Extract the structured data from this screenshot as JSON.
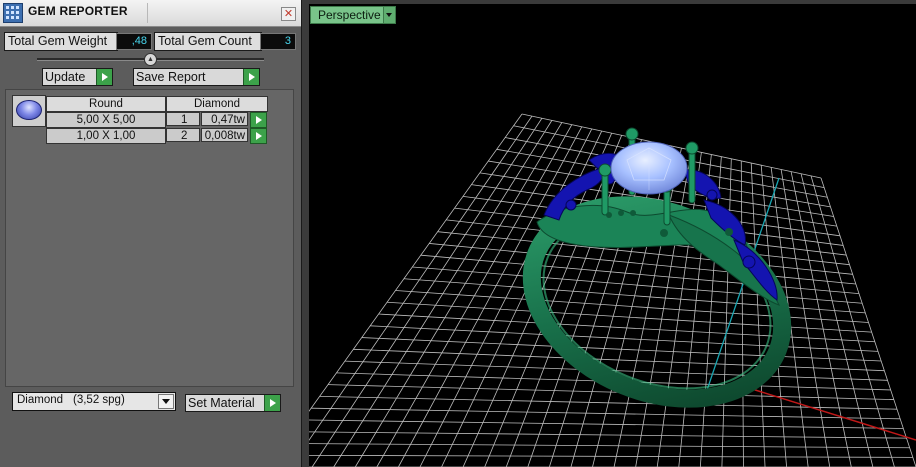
{
  "panel": {
    "title": "GEM REPORTER",
    "close_label": "✕",
    "total_weight_label": "Total Gem Weight",
    "total_weight_value": ",48",
    "total_count_label": "Total Gem Count",
    "total_count_value": "3",
    "update_label": "Update",
    "save_report_label": "Save Report"
  },
  "gem_table": {
    "columns": [
      "Round",
      "Diamond"
    ],
    "rows": [
      {
        "size": "5,00 X 5,00",
        "count": "1",
        "weight": "0,47tw"
      },
      {
        "size": "1,00 X 1,00",
        "count": "2",
        "weight": "0,008tw"
      }
    ]
  },
  "material": {
    "selected_name": "Diamond",
    "selected_density": "(3,52 spg)",
    "set_material_label": "Set Material"
  },
  "viewport": {
    "view_mode": "Perspective"
  },
  "icons": [
    "app-icon",
    "close-icon",
    "play-arrow-icon",
    "gem-round-icon",
    "chevron-down-icon"
  ],
  "colors": {
    "metal": "#1e7a52",
    "accent_gems": "#1212a8",
    "center_stone": "#8fb0ff",
    "button_green": "#3ca24a",
    "stat_value_text": "#48d7ee",
    "grid": "#bdbdbd"
  }
}
